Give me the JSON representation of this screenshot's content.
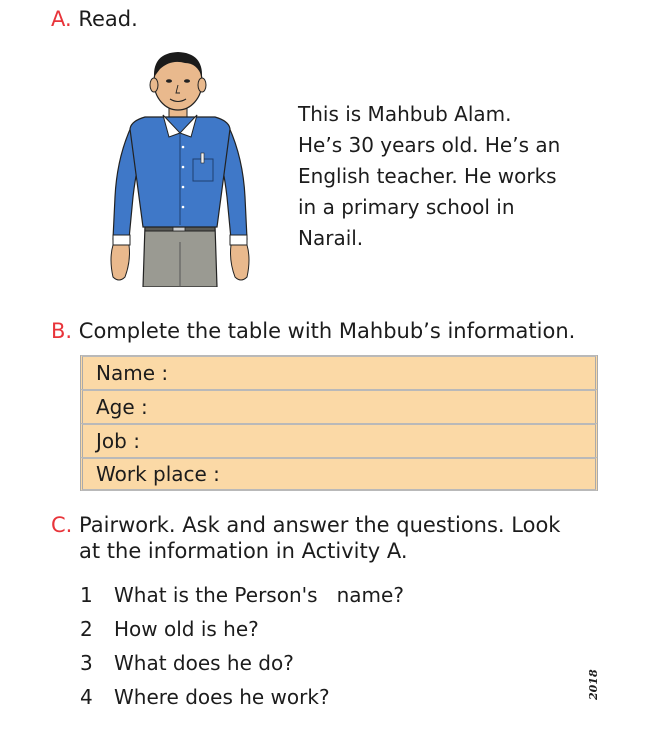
{
  "section_a": {
    "letter": "A.",
    "title": "Read."
  },
  "passage": [
    "This is Mahbub Alam.",
    "He’s 30 years old. He’s an",
    "English teacher. He works",
    "in a primary school in",
    "Narail."
  ],
  "section_b": {
    "letter": "B.",
    "title": "Complete the table with Mahbub’s information."
  },
  "table_rows": [
    "Name :",
    "Age :",
    "Job :",
    "Work place :"
  ],
  "section_c": {
    "letter": "C.",
    "title_line1": "Pairwork. Ask and answer the questions. Look",
    "title_line2": "at the information in Activity A."
  },
  "questions": [
    {
      "num": "1",
      "text": "What is the Person's   name?"
    },
    {
      "num": "2",
      "text": "How old is he?"
    },
    {
      "num": "3",
      "text": "What does he do?"
    },
    {
      "num": "4",
      "text": "Where does he work?"
    }
  ],
  "year": "2018",
  "colors": {
    "accent": "#e8343a",
    "table_fill": "#fbd9a6",
    "shirt": "#3f78c8",
    "trousers": "#9a9a92"
  }
}
